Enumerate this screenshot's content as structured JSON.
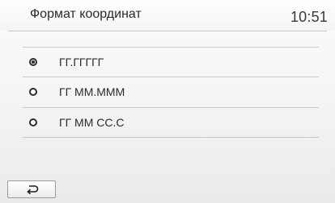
{
  "header": {
    "title": "Формат координат",
    "time": "10:51"
  },
  "options": [
    {
      "label": "ГГ.ГГГГГ",
      "selected": true
    },
    {
      "label": "ГГ ММ.МММ",
      "selected": false
    },
    {
      "label": "ГГ ММ СС.С",
      "selected": false
    }
  ],
  "footer": {
    "back_icon": "back-arrow-icon"
  }
}
